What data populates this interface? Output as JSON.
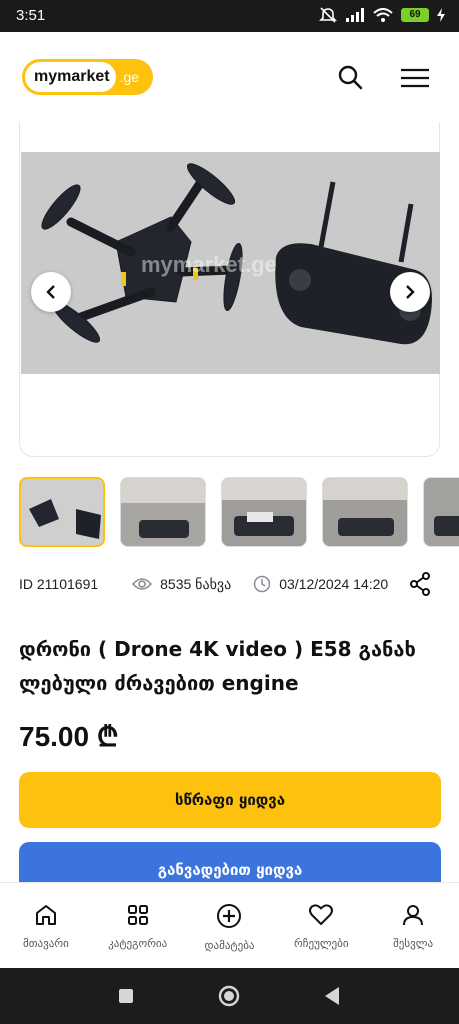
{
  "status_bar": {
    "time": "3:51",
    "battery": "69"
  },
  "header": {
    "logo_text": "mymarket",
    "logo_tld": ".ge",
    "icons": [
      "search-icon",
      "hamburger-menu-icon"
    ]
  },
  "gallery": {
    "watermark": "mymarket.ge",
    "thumbnail_count": 5
  },
  "meta": {
    "id": "ID 21101691",
    "views": "8535 ნახვა",
    "date": "03/12/2024 14:20"
  },
  "product": {
    "title_line1": "დრონი ( Drone 4K video ) E58 განახ",
    "title_line2": "ლებული ძრავებით engine",
    "price": "75.00 ₾"
  },
  "buttons": {
    "quick_buy": "სწრაფი ყიდვა",
    "installment_buy": "განვადებით ყიდვა"
  },
  "bottom_nav": [
    {
      "label": "მთავარი",
      "icon": "home-icon"
    },
    {
      "label": "კატეგორია",
      "icon": "categories-icon"
    },
    {
      "label": "დამატება",
      "icon": "add-icon"
    },
    {
      "label": "რჩეულები",
      "icon": "heart-icon"
    },
    {
      "label": "შესვლა",
      "icon": "user-icon"
    }
  ],
  "colors": {
    "accent": "#fec10d",
    "primary_blue": "#3c74dd"
  }
}
